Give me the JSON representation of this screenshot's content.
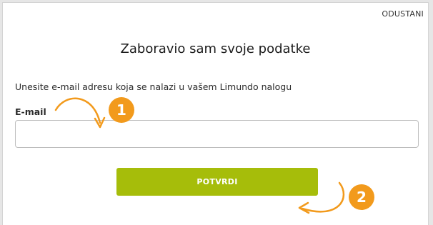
{
  "dialog": {
    "cancel_label": "ODUSTANI",
    "title": "Zaboravio sam svoje podatke",
    "instruction": "Unesite e-mail adresu koja se nalazi u vašem Limundo nalogu",
    "email_label": "E-mail",
    "email_value": "",
    "email_placeholder": "",
    "submit_label": "POTVRDI"
  },
  "annotations": {
    "step1": "1",
    "step2": "2",
    "badge_color": "#f29a1c",
    "arrow_color": "#f29a1c"
  },
  "colors": {
    "accent": "#a6bd0a",
    "background": "#ffffff"
  }
}
